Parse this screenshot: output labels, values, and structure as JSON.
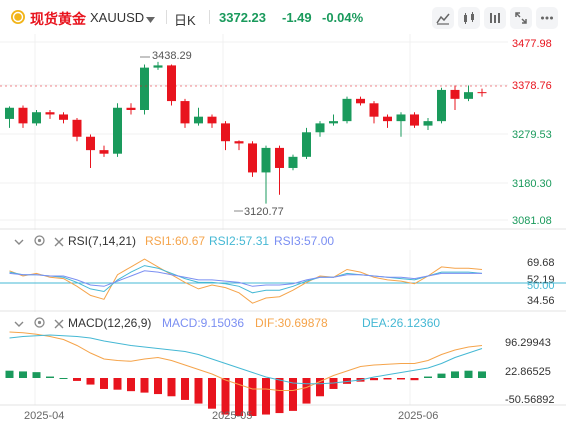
{
  "header": {
    "symbol_name": "现货黄金",
    "symbol_code": "XAUUSD",
    "timeframe": "日K",
    "last_price": "3372.23",
    "change": "-1.49",
    "change_pct": "-0.04%",
    "icons": [
      "gold-coin-icon",
      "chevron-down-icon",
      "candle-type-icon",
      "indicator-icon",
      "settings-sliders-icon",
      "expand-icon",
      "more-dots-icon"
    ]
  },
  "price_axis": [
    "3477.98",
    "3378.76",
    "3279.53",
    "3180.30",
    "3081.08"
  ],
  "current_price_label": "3378.76",
  "annotations": {
    "high": "3438.29",
    "low": "3120.77"
  },
  "rsi": {
    "title": "RSI(7,14,21)",
    "rsi1": "RSI1:60.67",
    "rsi2": "RSI2:57.31",
    "rsi3": "RSI3:57.00",
    "axis": [
      "69.68",
      "52.19",
      "50.00",
      "34.56"
    ],
    "colors": {
      "rsi1": "#f5a44b",
      "rsi2": "#45b8d4",
      "rsi3": "#7b8ff2"
    }
  },
  "macd": {
    "title": "MACD(12,26,9)",
    "macd": "MACD:9.15036",
    "dif": "DIF:30.69878",
    "dea": "DEA:26.12360",
    "axis": [
      "96.29943",
      "22.86525",
      "-50.56892"
    ],
    "colors": {
      "macd": "#7b8ff2",
      "dif": "#f5a44b",
      "dea": "#45b8d4"
    }
  },
  "x_axis": [
    "2025-04",
    "2025-05",
    "2025-06"
  ],
  "colors": {
    "up": "#1a9a5c",
    "down": "#e8141e",
    "accent": "#1a9a5c",
    "neg": "#e8141e"
  },
  "chart_data": {
    "type": "candlestick",
    "candles": [
      [
        3310,
        3335,
        3290,
        3338
      ],
      [
        3335,
        3300,
        3290,
        3340
      ],
      [
        3300,
        3325,
        3295,
        3330
      ],
      [
        3325,
        3320,
        3310,
        3330
      ],
      [
        3320,
        3308,
        3300,
        3325
      ],
      [
        3308,
        3270,
        3260,
        3312
      ],
      [
        3270,
        3240,
        3200,
        3275
      ],
      [
        3240,
        3232,
        3225,
        3250
      ],
      [
        3232,
        3335,
        3225,
        3345
      ],
      [
        3335,
        3330,
        3320,
        3345
      ],
      [
        3330,
        3425,
        3320,
        3432
      ],
      [
        3425,
        3430,
        3420,
        3438
      ],
      [
        3430,
        3350,
        3340,
        3432
      ],
      [
        3350,
        3300,
        3290,
        3355
      ],
      [
        3300,
        3315,
        3295,
        3335
      ],
      [
        3315,
        3300,
        3290,
        3320
      ],
      [
        3300,
        3260,
        3240,
        3305
      ],
      [
        3260,
        3255,
        3240,
        3262
      ],
      [
        3255,
        3190,
        3180,
        3260
      ],
      [
        3190,
        3245,
        3120,
        3250
      ],
      [
        3245,
        3200,
        3140,
        3250
      ],
      [
        3200,
        3225,
        3195,
        3230
      ],
      [
        3225,
        3280,
        3220,
        3290
      ],
      [
        3280,
        3300,
        3270,
        3305
      ],
      [
        3300,
        3305,
        3295,
        3320
      ],
      [
        3305,
        3355,
        3300,
        3360
      ],
      [
        3355,
        3345,
        3340,
        3360
      ],
      [
        3345,
        3315,
        3300,
        3350
      ],
      [
        3315,
        3305,
        3290,
        3320
      ],
      [
        3305,
        3320,
        3270,
        3325
      ],
      [
        3320,
        3295,
        3290,
        3325
      ],
      [
        3295,
        3305,
        3285,
        3312
      ],
      [
        3305,
        3375,
        3300,
        3380
      ],
      [
        3375,
        3355,
        3330,
        3385
      ],
      [
        3355,
        3370,
        3350,
        3385
      ],
      [
        3370,
        3368,
        3360,
        3378
      ]
    ],
    "candle_format": [
      "open",
      "close",
      "low",
      "high"
    ],
    "macd_hist": [
      10,
      9,
      8,
      2,
      0,
      -4,
      -9,
      -15,
      -16,
      -18,
      -20,
      -22,
      -25,
      -30,
      -35,
      -42,
      -50,
      -52,
      -52,
      -50,
      -48,
      -45,
      -35,
      -25,
      -15,
      -8,
      -5,
      -3,
      -2,
      -2,
      -3,
      2,
      6,
      9,
      10,
      9
    ],
    "rsi1": [
      59,
      55,
      57,
      54,
      53,
      47,
      40,
      37,
      56,
      62,
      68,
      62,
      56,
      50,
      45,
      48,
      46,
      42,
      34,
      38,
      39,
      44,
      50,
      55,
      54,
      60,
      58,
      54,
      52,
      51,
      49,
      55,
      62,
      61,
      61,
      60
    ],
    "rsi2": [
      58,
      56,
      56,
      55,
      54,
      50,
      45,
      43,
      52,
      58,
      63,
      61,
      57,
      53,
      50,
      50,
      49,
      47,
      42,
      44,
      44,
      47,
      51,
      54,
      54,
      57,
      56,
      55,
      54,
      53,
      52,
      55,
      58,
      58,
      58,
      57
    ],
    "rsi3": [
      57,
      56,
      56,
      55,
      55,
      52,
      48,
      47,
      51,
      55,
      59,
      58,
      56,
      54,
      52,
      52,
      51,
      50,
      47,
      48,
      48,
      49,
      52,
      54,
      54,
      56,
      56,
      55,
      54,
      54,
      53,
      55,
      57,
      57,
      57,
      57
    ],
    "dif": [
      48,
      47,
      45,
      42,
      38,
      30,
      20,
      12,
      10,
      9,
      12,
      14,
      10,
      4,
      -2,
      -8,
      -16,
      -22,
      -28,
      -28,
      -30,
      -30,
      -26,
      -18,
      -10,
      -4,
      2,
      4,
      5,
      6,
      6,
      10,
      18,
      24,
      28,
      30
    ],
    "dea": [
      40,
      42,
      43,
      44,
      43,
      42,
      40,
      36,
      33,
      30,
      28,
      26,
      24,
      22,
      18,
      12,
      6,
      0,
      -6,
      -12,
      -16,
      -20,
      -21,
      -21,
      -20,
      -18,
      -16,
      -12,
      -9,
      -6,
      -3,
      0,
      6,
      14,
      20,
      26
    ]
  }
}
